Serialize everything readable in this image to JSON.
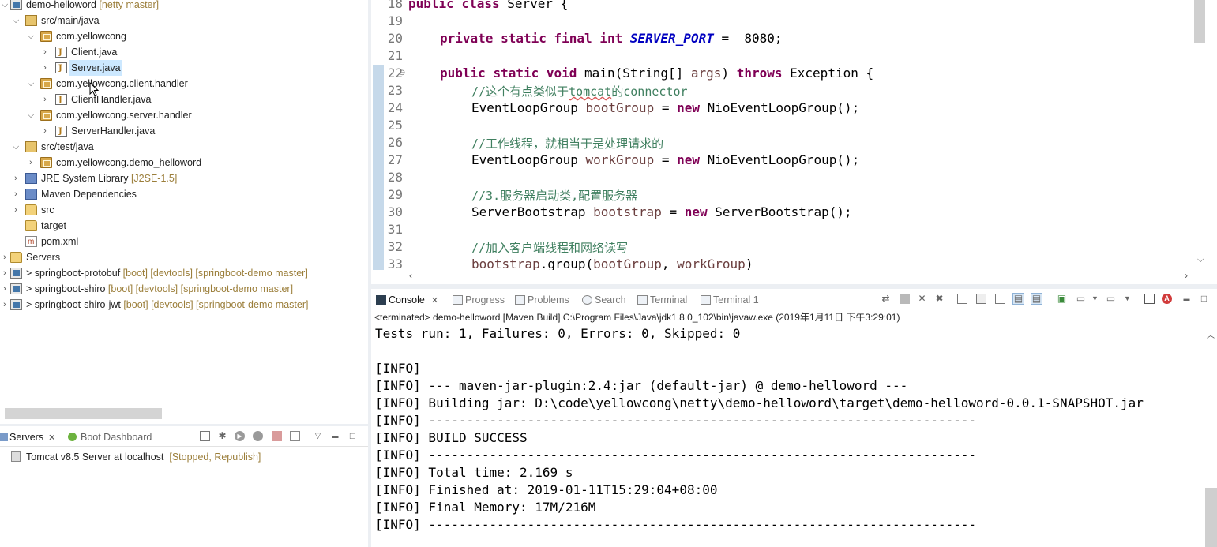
{
  "explorer": {
    "rows": [
      {
        "label": "demo-helloword",
        "decoration": "[netty master]"
      },
      {
        "label": "src/main/java",
        "decoration": ""
      },
      {
        "label": "com.yellowcong",
        "decoration": ""
      },
      {
        "label": "Client.java",
        "decoration": ""
      },
      {
        "label": "Server.java",
        "decoration": ""
      },
      {
        "label": "com.yellowcong.client.handler",
        "decoration": ""
      },
      {
        "label": "ClientHandler.java",
        "decoration": ""
      },
      {
        "label": "com.yellowcong.server.handler",
        "decoration": ""
      },
      {
        "label": "ServerHandler.java",
        "decoration": ""
      },
      {
        "label": "src/test/java",
        "decoration": ""
      },
      {
        "label": "com.yellowcong.demo_helloword",
        "decoration": ""
      },
      {
        "label": "JRE System Library",
        "decoration": "[J2SE-1.5]"
      },
      {
        "label": "Maven Dependencies",
        "decoration": ""
      },
      {
        "label": "src",
        "decoration": ""
      },
      {
        "label": "target",
        "decoration": ""
      },
      {
        "label": "pom.xml",
        "decoration": ""
      },
      {
        "label": "Servers",
        "decoration": ""
      },
      {
        "label": "> springboot-protobuf",
        "decoration": "[boot] [devtools] [springboot-demo master]"
      },
      {
        "label": "> springboot-shiro",
        "decoration": "[boot] [devtools] [springboot-demo master]"
      },
      {
        "label": "> springboot-shiro-jwt",
        "decoration": "[boot] [devtools] [springboot-demo master]"
      }
    ]
  },
  "servers_view": {
    "tab_servers": "Servers",
    "tab_boot_dashboard": "Boot Dashboard",
    "server_name": "Tomcat v8.5 Server at localhost",
    "server_state": "[Stopped, Republish]"
  },
  "editor": {
    "line_numbers": [
      "18",
      "19",
      "20",
      "21",
      "22",
      "23",
      "24",
      "25",
      "26",
      "27",
      "28",
      "29",
      "30",
      "31",
      "32",
      "33"
    ],
    "line18": {
      "kw1": "public",
      "kw2": "class",
      "rest": "Server {"
    },
    "line20": {
      "kw1": "private",
      "kw2": "static",
      "kw3": "final",
      "kw4": "int",
      "field": "SERVER_PORT",
      "rest": " =  8080;"
    },
    "line22": {
      "kw1": "public",
      "kw2": "static",
      "kw3": "void",
      "sig": "main(String[] ",
      "param": "args",
      "close": ")",
      "kw4": "throws",
      "rest": " Exception {"
    },
    "line23": {
      "comment_prefix": "//这个有点类似于",
      "comment_err": "tomcat",
      "comment_suffix": "的connector"
    },
    "line24": {
      "type": "EventLoopGroup ",
      "var": "bootGroup",
      "eq": " = ",
      "kw": "new",
      "rest": " NioEventLoopGroup();"
    },
    "line26": {
      "comment": "//工作线程，就相当于是处理请求的"
    },
    "line27": {
      "type": "EventLoopGroup ",
      "var": "workGroup",
      "eq": " = ",
      "kw": "new",
      "rest": " NioEventLoopGroup();"
    },
    "line29": {
      "comment": "//3.服务器启动类,配置服务器"
    },
    "line30": {
      "type": "ServerBootstrap ",
      "var": "bootstrap",
      "eq": " = ",
      "kw": "new",
      "rest": " ServerBootstrap();"
    },
    "line32": {
      "comment": "//加入客户端线程和网络读写"
    },
    "line33": {
      "obj": "bootstrap",
      "call": ".group(",
      "arg1": "bootGroup",
      "sep": ", ",
      "arg2": "workGroup",
      "end": ")"
    }
  },
  "console_view": {
    "tabs": [
      "Console",
      "Progress",
      "Problems",
      "Search",
      "Terminal",
      "Terminal 1"
    ],
    "status": "<terminated> demo-helloword [Maven Build] C:\\Program Files\\Java\\jdk1.8.0_102\\bin\\javaw.exe (2019年1月11日 下午3:29:01)",
    "lines": [
      "Tests run: 1, Failures: 0, Errors: 0, Skipped: 0",
      "",
      "[INFO]",
      "[INFO] --- maven-jar-plugin:2.4:jar (default-jar) @ demo-helloword ---",
      "[INFO] Building jar: D:\\code\\yellowcong\\netty\\demo-helloword\\target\\demo-helloword-0.0.1-SNAPSHOT.jar",
      "[INFO] ------------------------------------------------------------------------",
      "[INFO] BUILD SUCCESS",
      "[INFO] ------------------------------------------------------------------------",
      "[INFO] Total time: 2.169 s",
      "[INFO] Finished at: 2019-01-11T15:29:04+08:00",
      "[INFO] Final Memory: 17M/216M",
      "[INFO] ------------------------------------------------------------------------"
    ]
  },
  "icons": {
    "close": "✕",
    "collapse_arrow": "⌵",
    "expand_arrow": "›",
    "view_menu": "▽",
    "minimize": "▬",
    "maximize": "□"
  }
}
